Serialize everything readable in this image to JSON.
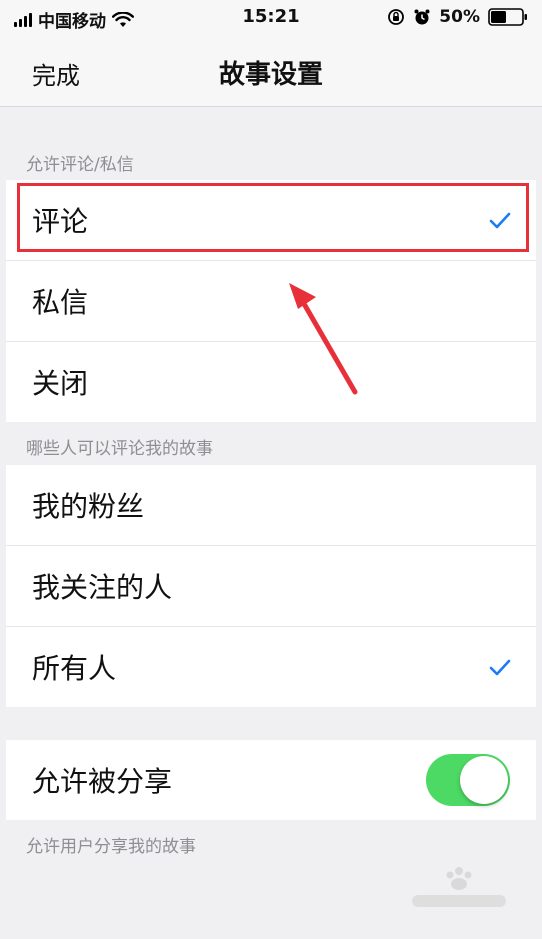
{
  "status_bar": {
    "carrier": "中国移动",
    "time": "15:21",
    "battery_percent": "50%",
    "battery_level": 0.5,
    "icons": [
      "signal-icon",
      "wifi-icon",
      "orientation-lock-icon",
      "alarm-icon",
      "battery-icon"
    ]
  },
  "nav": {
    "left_label": "完成",
    "title": "故事设置"
  },
  "sections": {
    "comments": {
      "header": "允许评论/私信",
      "items": [
        {
          "label": "评论",
          "checked": true
        },
        {
          "label": "私信",
          "checked": false
        },
        {
          "label": "关闭",
          "checked": false
        }
      ]
    },
    "audience": {
      "header": "哪些人可以评论我的故事",
      "items": [
        {
          "label": "我的粉丝",
          "checked": false
        },
        {
          "label": "我关注的人",
          "checked": false
        },
        {
          "label": "所有人",
          "checked": true
        }
      ]
    },
    "share": {
      "label": "允许被分享",
      "toggle_on": true,
      "footer": "允许用户分享我的故事"
    }
  },
  "colors": {
    "accent": "#1a7cf5",
    "toggle_on": "#4cd964",
    "highlight": "#e8303a"
  }
}
